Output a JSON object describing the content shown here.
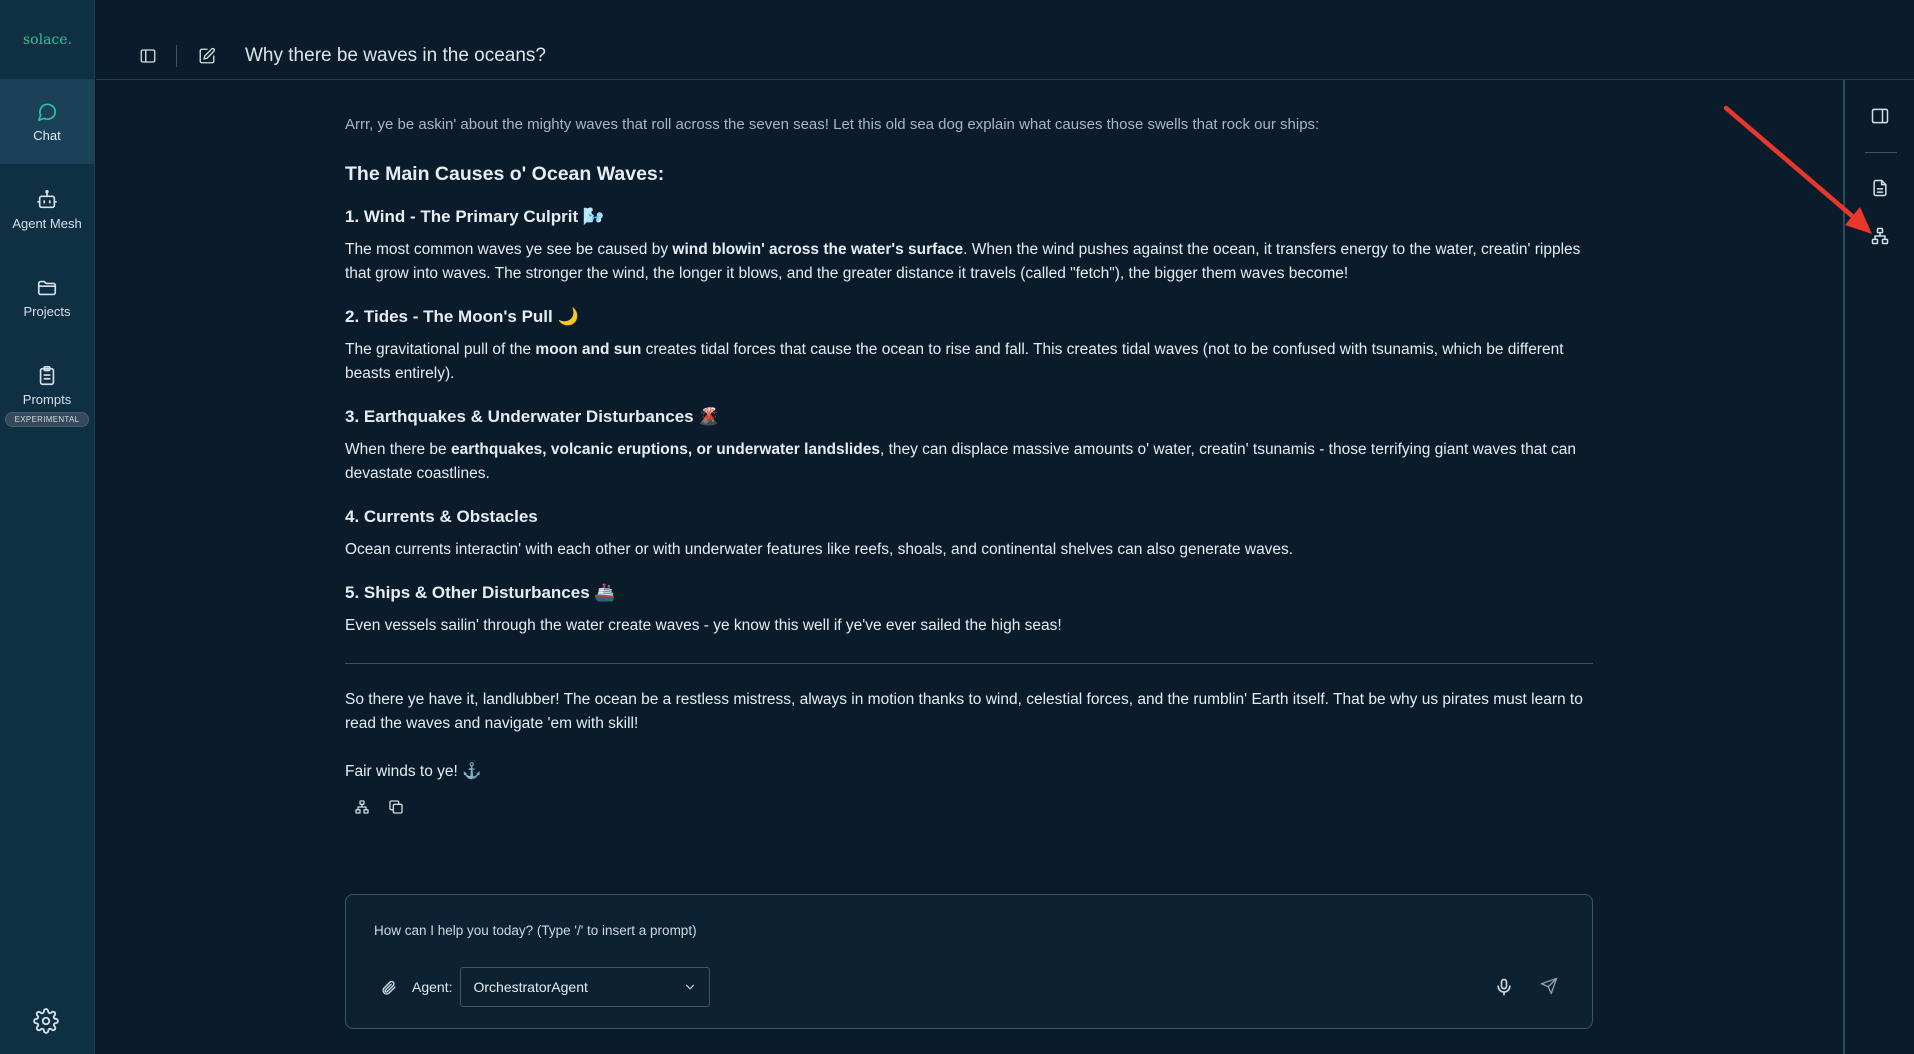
{
  "app": {
    "logo": "solace."
  },
  "nav": {
    "items": [
      {
        "label": "Chat",
        "icon": "chat-bubble-icon",
        "active": true
      },
      {
        "label": "Agent Mesh",
        "icon": "robot-icon"
      },
      {
        "label": "Projects",
        "icon": "folder-icon"
      },
      {
        "label": "Prompts",
        "icon": "clipboard-icon",
        "badge": "EXPERIMENTAL"
      }
    ],
    "settings_icon": "gear-icon"
  },
  "header": {
    "title": "Why there be waves in the oceans?"
  },
  "message": {
    "intro": "Arrr, ye be askin' about the mighty waves that roll across the seven seas! Let this old sea dog explain what causes those swells that rock our ships:",
    "heading": "The Main Causes o' Ocean Waves:",
    "sections": [
      {
        "title": "1. Wind - The Primary Culprit 🌬️",
        "pre": "The most common waves ye see be caused by ",
        "bold": "wind blowin' across the water's surface",
        "post": ". When the wind pushes against the ocean, it transfers energy to the water, creatin' ripples that grow into waves. The stronger the wind, the longer it blows, and the greater distance it travels (called \"fetch\"), the bigger them waves become!"
      },
      {
        "title": "2. Tides - The Moon's Pull 🌙",
        "pre": "The gravitational pull of the ",
        "bold": "moon and sun",
        "post": " creates tidal forces that cause the ocean to rise and fall. This creates tidal waves (not to be confused with tsunamis, which be different beasts entirely)."
      },
      {
        "title": "3. Earthquakes & Underwater Disturbances 🌋",
        "pre": "When there be ",
        "bold": "earthquakes, volcanic eruptions, or underwater landslides",
        "post": ", they can displace massive amounts o' water, creatin' tsunamis - those terrifying giant waves that can devastate coastlines."
      },
      {
        "title": "4. Currents & Obstacles",
        "pre": "Ocean currents interactin' with each other or with underwater features like reefs, shoals, and continental shelves can also generate waves.",
        "bold": "",
        "post": ""
      },
      {
        "title": "5. Ships & Other Disturbances 🚢",
        "pre": "Even vessels sailin' through the water create waves - ye know this well if ye've ever sailed the high seas!",
        "bold": "",
        "post": ""
      }
    ],
    "closing": "So there ye have it, landlubber! The ocean be a restless mistress, always in motion thanks to wind, celestial forces, and the rumblin' Earth itself. That be why us pirates must learn to read the waves and navigate 'em with skill!",
    "signoff": "Fair winds to ye! ⚓"
  },
  "composer": {
    "placeholder": "How can I help you today? (Type '/' to insert a prompt)",
    "agent_label": "Agent:",
    "agent_value": "OrchestratorAgent"
  },
  "colors": {
    "accent": "#2ec4a0",
    "background": "#0a1c2c",
    "sidebar": "#0f2f43",
    "annotation": "#e8382b"
  }
}
